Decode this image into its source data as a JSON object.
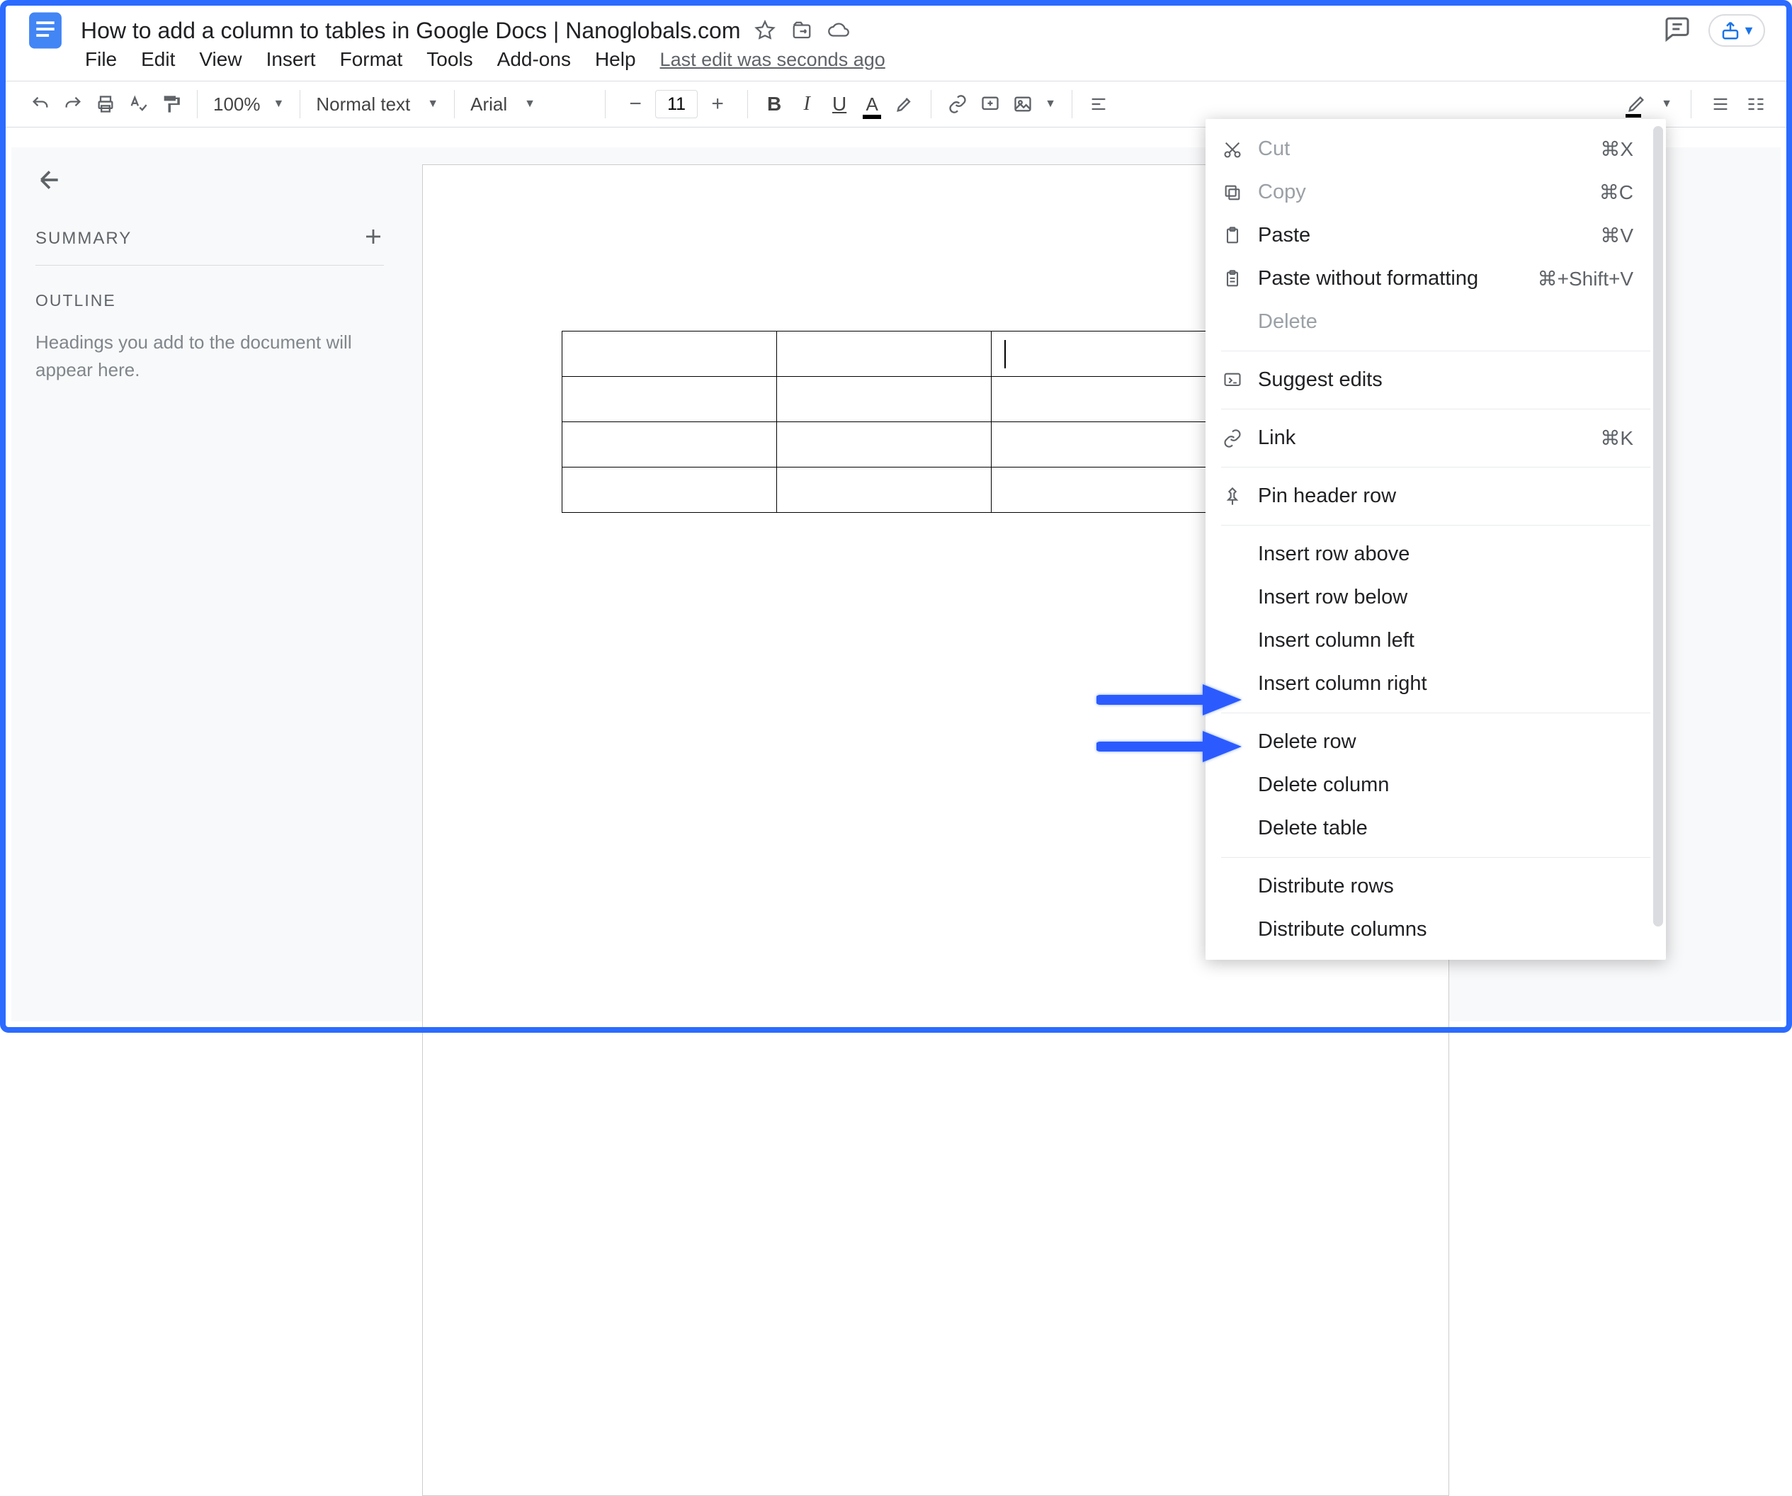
{
  "document": {
    "title": "How to add a column to tables in Google Docs | Nanoglobals.com",
    "edit_info": "Last edit was seconds ago"
  },
  "menus": {
    "file": "File",
    "edit": "Edit",
    "view": "View",
    "insert": "Insert",
    "format": "Format",
    "tools": "Tools",
    "addons": "Add-ons",
    "help": "Help"
  },
  "toolbar": {
    "zoom": "100%",
    "style": "Normal text",
    "font": "Arial",
    "size": "11"
  },
  "sidebar": {
    "summary_label": "SUMMARY",
    "outline_label": "OUTLINE",
    "outline_hint": "Headings you add to the document will appear here."
  },
  "context_menu": {
    "cut": {
      "label": "Cut",
      "shortcut": "⌘X"
    },
    "copy": {
      "label": "Copy",
      "shortcut": "⌘C"
    },
    "paste": {
      "label": "Paste",
      "shortcut": "⌘V"
    },
    "paste_plain": {
      "label": "Paste without formatting",
      "shortcut": "⌘+Shift+V"
    },
    "delete": {
      "label": "Delete"
    },
    "suggest": {
      "label": "Suggest edits"
    },
    "link": {
      "label": "Link",
      "shortcut": "⌘K"
    },
    "pin_header": {
      "label": "Pin header row"
    },
    "insert_row_above": {
      "label": "Insert row above"
    },
    "insert_row_below": {
      "label": "Insert row below"
    },
    "insert_col_left": {
      "label": "Insert column left"
    },
    "insert_col_right": {
      "label": "Insert column right"
    },
    "delete_row": {
      "label": "Delete row"
    },
    "delete_col": {
      "label": "Delete column"
    },
    "delete_table": {
      "label": "Delete table"
    },
    "distribute_rows": {
      "label": "Distribute rows"
    },
    "distribute_cols": {
      "label": "Distribute columns"
    }
  },
  "table": {
    "rows": 4,
    "cols": 3
  }
}
